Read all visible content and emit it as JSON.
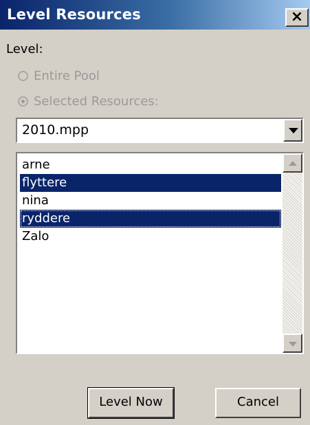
{
  "window": {
    "title": "Level Resources",
    "close_glyph": "×"
  },
  "level": {
    "label": "Level:",
    "options": [
      {
        "label": "Entire Pool",
        "selected": false,
        "enabled": false
      },
      {
        "label": "Selected Resources:",
        "selected": true,
        "enabled": false
      }
    ]
  },
  "project_select": {
    "value": "2010.mpp"
  },
  "resources": {
    "items": [
      {
        "label": "arne",
        "selected": false
      },
      {
        "label": "flyttere",
        "selected": true
      },
      {
        "label": "nina",
        "selected": false
      },
      {
        "label": "ryddere",
        "selected": true
      },
      {
        "label": "Zalo",
        "selected": false
      }
    ]
  },
  "buttons": {
    "level_now": "Level Now",
    "cancel": "Cancel"
  },
  "colors": {
    "title_bar_start": "#0a246a",
    "selection": "#0a246a",
    "dialog_bg": "#d4d0c8"
  }
}
